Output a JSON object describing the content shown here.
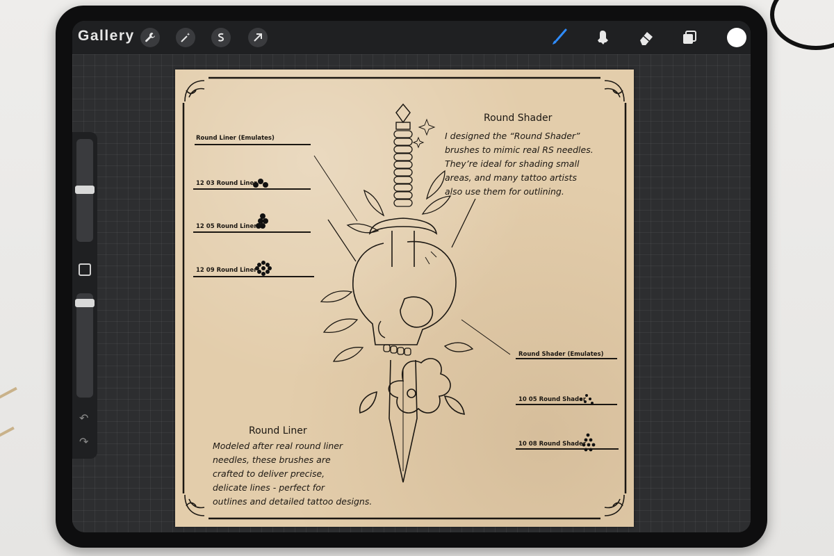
{
  "topbar": {
    "gallery_label": "Gallery",
    "tools_left": [
      "wrench-icon",
      "magic-wand-icon",
      "selection-s-icon",
      "transform-arrow-icon"
    ],
    "tools_right": [
      "brush-icon",
      "smudge-icon",
      "eraser-icon",
      "layers-icon",
      "color-icon"
    ],
    "active_color": "#ffffff",
    "brush_active_color": "#2f8cff"
  },
  "canvas": {
    "round_shader": {
      "heading": "Round Shader",
      "lines": [
        "I designed the “Round Shader”",
        "brushes to mimic real RS needles.",
        "They’re ideal for shading small",
        "areas, and many tattoo artists",
        "also use them for outlining."
      ]
    },
    "round_liner": {
      "heading": "Round Liner",
      "lines": [
        "Modeled after real round liner",
        "needles, these brushes are",
        "crafted to deliver precise,",
        "delicate lines - perfect for",
        "outlines and detailed tattoo designs."
      ]
    },
    "liner_labels": {
      "emulates": "Round Liner (Emulates)",
      "l03": "12 03 Round Liner",
      "l05": "12 05 Round Liner",
      "l09": "12 09 Round Liner"
    },
    "shader_labels": {
      "emulates": "Round Shader (Emulates)",
      "s05": "10 05 Round Shader",
      "s08": "10 08 Round Shader"
    }
  }
}
